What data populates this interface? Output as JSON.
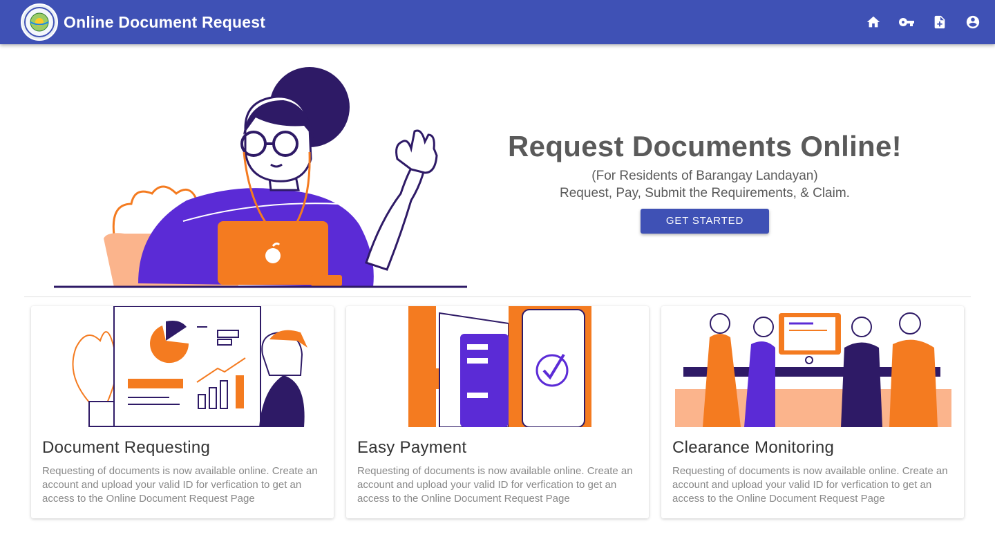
{
  "header": {
    "title": "Online Document Request",
    "logo_icon": "barangay-seal-icon",
    "logo_text": "BARANGAY LANDAYAN",
    "nav": [
      {
        "name": "home",
        "icon": "home-icon"
      },
      {
        "name": "login",
        "icon": "key-icon"
      },
      {
        "name": "request",
        "icon": "add-document-icon"
      },
      {
        "name": "account",
        "icon": "account-circle-icon"
      }
    ],
    "color": "#3f51b5"
  },
  "hero": {
    "title": "Request Documents Online!",
    "subtitle": "(For Residents of Barangay Landayan)",
    "tagline": "Request, Pay, Submit the Requirements, & Claim.",
    "cta_label": "GET STARTED"
  },
  "cards": [
    {
      "title": "Document Requesting",
      "text": "Requesting of documents is now available online. Create an account and upload your valid ID for verfication to get an access to the Online Document Request Page"
    },
    {
      "title": "Easy Payment",
      "text": "Requesting of documents is now available online. Create an account and upload your valid ID for verfication to get an access to the Online Document Request Page"
    },
    {
      "title": "Clearance Monitoring",
      "text": "Requesting of documents is now available online. Create an account and upload your valid ID for verfication to get an access to the Online Document Request Page"
    }
  ],
  "colors": {
    "accent_orange": "#f47b20",
    "accent_purple": "#5b2bd6",
    "dark_purple": "#2e1a66",
    "peach": "#fbb48c"
  }
}
